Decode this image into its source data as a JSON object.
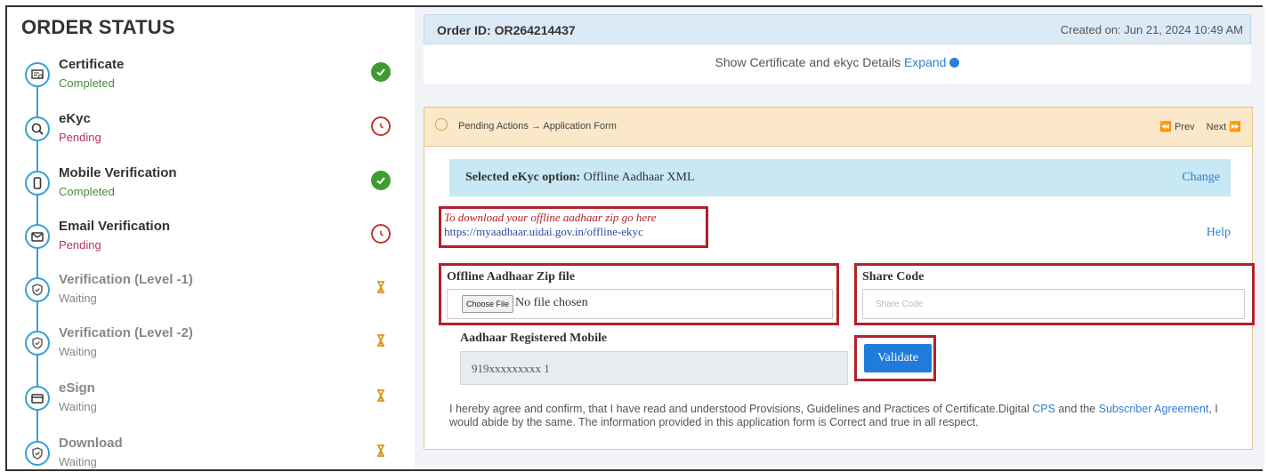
{
  "order_status": {
    "title": "ORDER STATUS",
    "steps": [
      {
        "name": "Certificate",
        "status": "Completed",
        "state": "completed",
        "icon": "certificate-icon"
      },
      {
        "name": "eKyc",
        "status": "Pending",
        "state": "pending",
        "icon": "search-icon"
      },
      {
        "name": "Mobile Verification",
        "status": "Completed",
        "state": "completed",
        "icon": "mobile-icon"
      },
      {
        "name": "Email Verification",
        "status": "Pending",
        "state": "pending",
        "icon": "email-icon"
      },
      {
        "name": "Verification (Level -1)",
        "status": "Waiting",
        "state": "waiting",
        "icon": "shield-icon"
      },
      {
        "name": "Verification (Level -2)",
        "status": "Waiting",
        "state": "waiting",
        "icon": "shield-icon"
      },
      {
        "name": "eSign",
        "status": "Waiting",
        "state": "waiting",
        "icon": "card-icon"
      },
      {
        "name": "Download",
        "status": "Waiting",
        "state": "waiting",
        "icon": "shield-icon"
      }
    ]
  },
  "order": {
    "id_label": "Order ID: OR264214437",
    "created": "Created on: Jun 21, 2024 10:49 AM",
    "details_text": "Show Certificate and ekyc Details",
    "expand_label": "Expand"
  },
  "pending_panel": {
    "breadcrumb": "Pending Actions → Application Form",
    "prev_label": "⏪ Prev",
    "next_label": "Next ⏩"
  },
  "ekyc": {
    "selected_label": "Selected eKyc option:",
    "selected_value": "Offline Aadhaar XML",
    "change_label": "Change"
  },
  "download": {
    "note": "To download your offline aadhaar zip go here",
    "url": "https://myaadhaar.uidai.gov.in/offline-ekyc",
    "help_label": "Help"
  },
  "form": {
    "zip_label": "Offline Aadhaar Zip file",
    "choose_file_label": "Choose File",
    "no_file_label": "No file chosen",
    "share_code_label": "Share Code",
    "share_code_placeholder": "Share Code",
    "mobile_label": "Aadhaar Registered Mobile",
    "mobile_value": "919xxxxxxxxx 1",
    "validate_label": "Validate"
  },
  "agreement": {
    "part1": "I hereby agree and confirm, that I have read and understood Provisions, Guidelines and Practices of Certificate.Digital",
    "cps_link": "CPS",
    "part2": "and the",
    "subscriber_link": "Subscriber Agreement",
    "part3": ", I would abide by the same. The information provided in this application form is Correct and true in all respect."
  },
  "colors": {
    "accent": "#3aa0d0",
    "completed": "#3f9d2f",
    "pending": "#c0392b",
    "waiting": "#e0a020",
    "highlight_box": "#b3202a",
    "primary_button": "#1f7bdc"
  }
}
